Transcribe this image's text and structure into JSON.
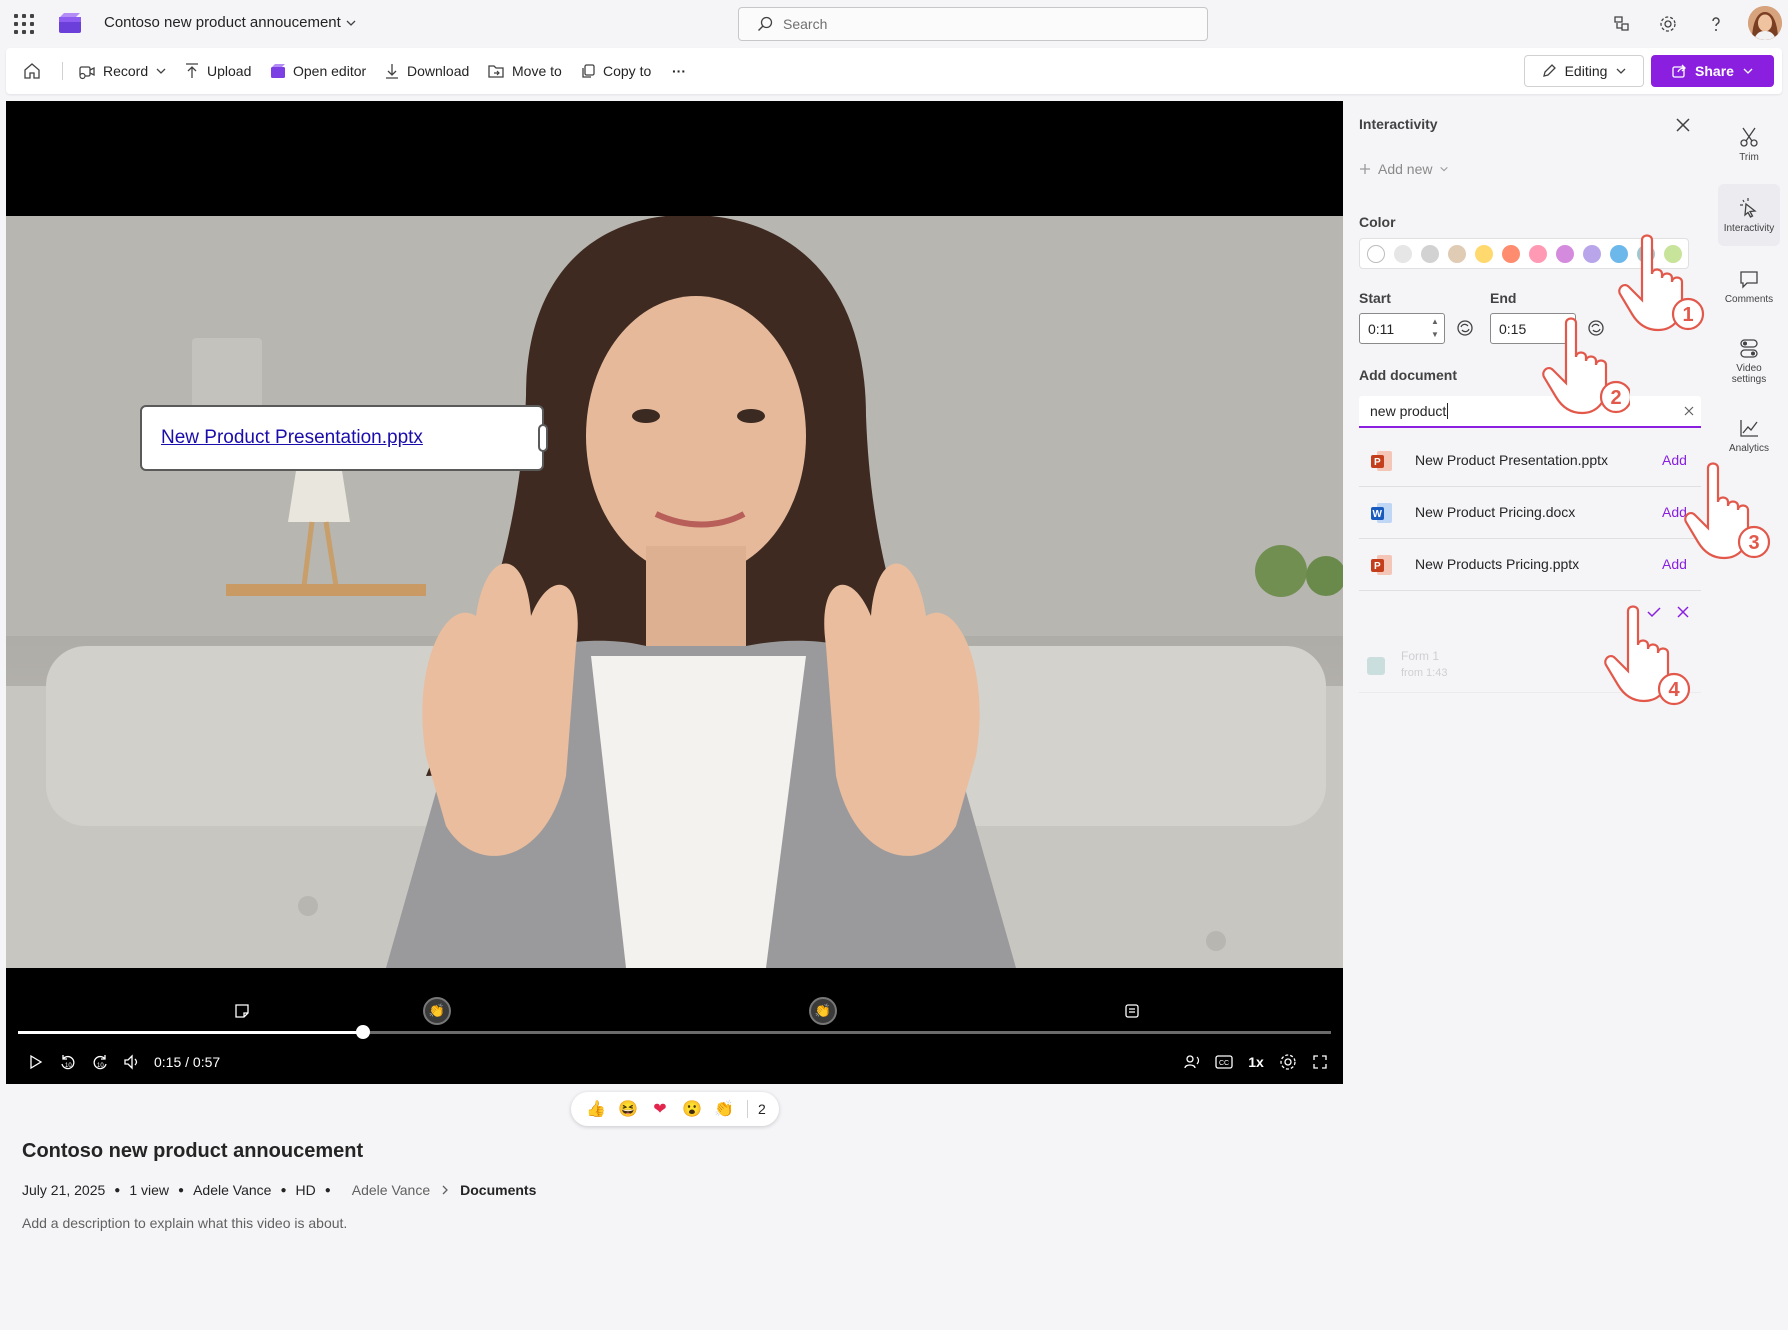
{
  "topbar": {
    "title": "Contoso new product annoucement",
    "search_placeholder": "Search",
    "icons": [
      "waffle-icon",
      "share-feedback-icon",
      "gear-icon",
      "help-icon",
      "avatar"
    ]
  },
  "toolbar": {
    "record": "Record",
    "upload": "Upload",
    "open_editor": "Open editor",
    "download": "Download",
    "move_to": "Move to",
    "copy_to": "Copy to",
    "more": "···",
    "editing": "Editing",
    "share": "Share"
  },
  "video": {
    "overlay_document": "New Product Presentation.pptx",
    "current_time": "0:15",
    "duration": "0:57",
    "time_readout": "0:15 / 0:57",
    "progress": 0.263,
    "speed": "1x",
    "marker_icons": [
      "note-icon",
      "clap-reaction-icon",
      "clap-reaction-icon",
      "form-icon"
    ]
  },
  "reactions": {
    "items": [
      "👍",
      "😆",
      "❤",
      "😮",
      "👏"
    ],
    "count": "2"
  },
  "info": {
    "title": "Contoso new product annoucement",
    "date": "July 21, 2025",
    "views": "1 view",
    "author": "Adele Vance",
    "quality": "HD",
    "path_owner": "Adele Vance",
    "path_folder": "Documents",
    "description": "Add a description to explain what this video is about."
  },
  "panel": {
    "title": "Interactivity",
    "add_new": "Add new",
    "color_label": "Color",
    "colors": [
      "#ffffff",
      "#e6e6e6",
      "#d2d2d2",
      "#e0cbb4",
      "#ffd86e",
      "#ff8c6e",
      "#ff99b4",
      "#d58bdd",
      "#b9a6ea",
      "#6cb8ea",
      "#9fc7cf",
      "#c8e39a"
    ],
    "start_label": "Start",
    "start_value": "0:11",
    "end_label": "End",
    "end_value": "0:15",
    "add_document_label": "Add document",
    "search_value": "new product",
    "results": [
      {
        "name": "New Product Presentation.pptx",
        "type": "pptx",
        "action": "Add"
      },
      {
        "name": "New Product Pricing.docx",
        "type": "docx",
        "action": "Add"
      },
      {
        "name": "New Products Pricing.pptx",
        "type": "pptx",
        "action": "Add"
      }
    ],
    "ghost_title": "Form 1",
    "ghost_sub": "from 1:43"
  },
  "rail": {
    "items": [
      {
        "label": "Trim",
        "icon": "scissors-icon"
      },
      {
        "label": "Interactivity",
        "icon": "interactivity-icon"
      },
      {
        "label": "Comments",
        "icon": "comment-icon"
      },
      {
        "label": "Video settings",
        "icon": "video-settings-icon"
      },
      {
        "label": "Analytics",
        "icon": "analytics-icon"
      }
    ]
  },
  "annotations": [
    "1",
    "2",
    "3",
    "4"
  ],
  "colors": {
    "accent": "#8a1fe0",
    "annotation": "#e2594b"
  }
}
